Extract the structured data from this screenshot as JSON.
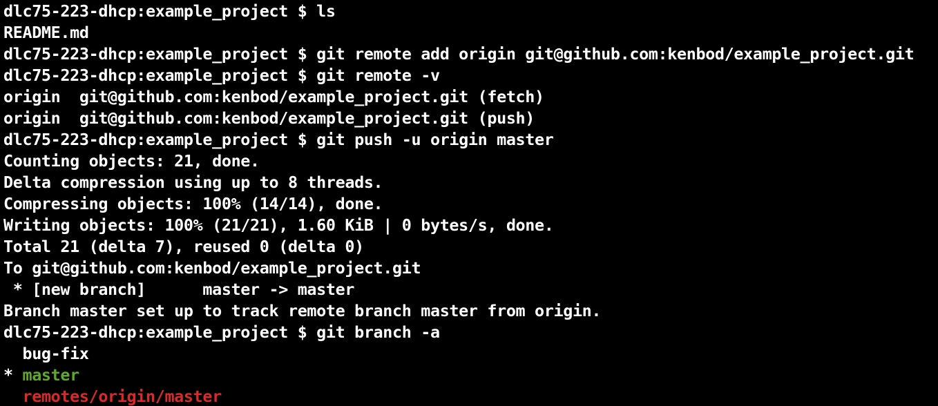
{
  "terminal": {
    "background": "#000000",
    "colors": {
      "default": "#ffffff",
      "green": "#5fa82a",
      "red": "#d92a2a"
    },
    "lines": [
      {
        "type": "command",
        "segments": [
          {
            "text": "dlc75-223-dhcp:example_project $ ls",
            "color": "default"
          }
        ]
      },
      {
        "type": "output",
        "segments": [
          {
            "text": "README.md",
            "color": "default"
          }
        ]
      },
      {
        "type": "command",
        "segments": [
          {
            "text": "dlc75-223-dhcp:example_project $ git remote add origin git@github.com:kenbod/example_project.git",
            "color": "default"
          }
        ]
      },
      {
        "type": "command",
        "segments": [
          {
            "text": "dlc75-223-dhcp:example_project $ git remote -v",
            "color": "default"
          }
        ]
      },
      {
        "type": "output",
        "segments": [
          {
            "text": "origin  git@github.com:kenbod/example_project.git (fetch)",
            "color": "default"
          }
        ]
      },
      {
        "type": "output",
        "segments": [
          {
            "text": "origin  git@github.com:kenbod/example_project.git (push)",
            "color": "default"
          }
        ]
      },
      {
        "type": "command",
        "segments": [
          {
            "text": "dlc75-223-dhcp:example_project $ git push -u origin master",
            "color": "default"
          }
        ]
      },
      {
        "type": "output",
        "segments": [
          {
            "text": "Counting objects: 21, done.",
            "color": "default"
          }
        ]
      },
      {
        "type": "output",
        "segments": [
          {
            "text": "Delta compression using up to 8 threads.",
            "color": "default"
          }
        ]
      },
      {
        "type": "output",
        "segments": [
          {
            "text": "Compressing objects: 100% (14/14), done.",
            "color": "default"
          }
        ]
      },
      {
        "type": "output",
        "segments": [
          {
            "text": "Writing objects: 100% (21/21), 1.60 KiB | 0 bytes/s, done.",
            "color": "default"
          }
        ]
      },
      {
        "type": "output",
        "segments": [
          {
            "text": "Total 21 (delta 7), reused 0 (delta 0)",
            "color": "default"
          }
        ]
      },
      {
        "type": "output",
        "segments": [
          {
            "text": "To git@github.com:kenbod/example_project.git",
            "color": "default"
          }
        ]
      },
      {
        "type": "output",
        "segments": [
          {
            "text": " * [new branch]      master -> master",
            "color": "default"
          }
        ]
      },
      {
        "type": "output",
        "segments": [
          {
            "text": "Branch master set up to track remote branch master from origin.",
            "color": "default"
          }
        ]
      },
      {
        "type": "command",
        "segments": [
          {
            "text": "dlc75-223-dhcp:example_project $ git branch -a",
            "color": "default"
          }
        ]
      },
      {
        "type": "output",
        "segments": [
          {
            "text": "  bug-fix",
            "color": "default"
          }
        ]
      },
      {
        "type": "output",
        "segments": [
          {
            "text": "* ",
            "color": "default"
          },
          {
            "text": "master",
            "color": "green"
          }
        ]
      },
      {
        "type": "output",
        "segments": [
          {
            "text": "  ",
            "color": "default"
          },
          {
            "text": "remotes/origin/master",
            "color": "red"
          }
        ]
      }
    ]
  }
}
